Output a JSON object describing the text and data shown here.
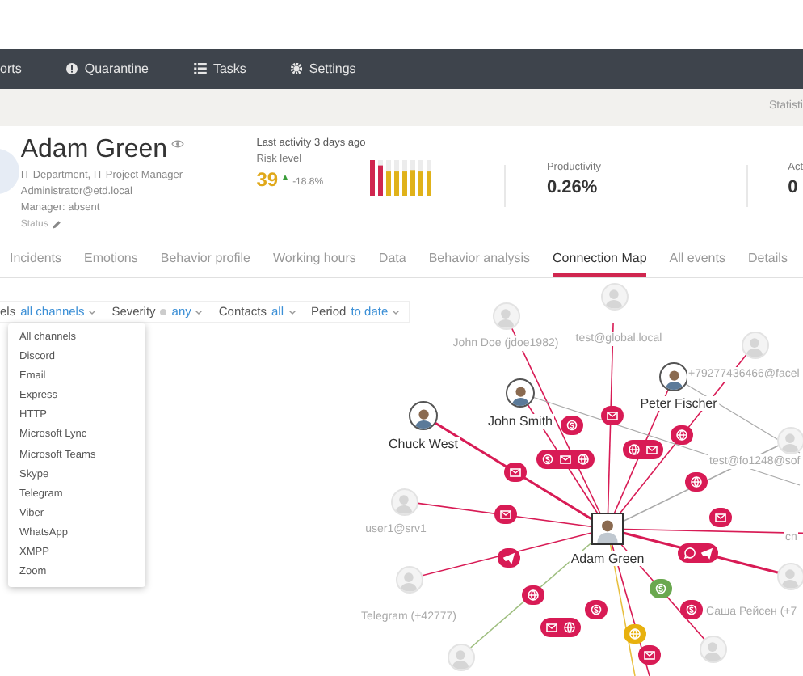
{
  "nav": {
    "items": [
      {
        "label": "orts"
      },
      {
        "label": "Quarantine"
      },
      {
        "label": "Tasks"
      },
      {
        "label": "Settings"
      }
    ]
  },
  "sub_bar": {
    "link": "Statisti"
  },
  "profile": {
    "name": "Adam Green",
    "department": "IT Department, IT Project Manager",
    "email": "Administrator@etd.local",
    "manager": "Manager: absent",
    "status": "Status"
  },
  "metrics": {
    "last_activity": "Last activity 3 days ago",
    "risk_label": "Risk level",
    "risk_value": "39",
    "risk_change": "-18.8%",
    "productivity_label": "Productivity",
    "productivity_value": "0.26%",
    "activity_label": "Act",
    "activity_value": "0"
  },
  "tabs": [
    {
      "label": "Incidents",
      "selected": false
    },
    {
      "label": "Emotions",
      "selected": false
    },
    {
      "label": "Behavior profile",
      "selected": false
    },
    {
      "label": "Working hours",
      "selected": false
    },
    {
      "label": "Data",
      "selected": false
    },
    {
      "label": "Behavior analysis",
      "selected": false
    },
    {
      "label": "Connection Map",
      "selected": true
    },
    {
      "label": "All events",
      "selected": false
    },
    {
      "label": "Details",
      "selected": false
    }
  ],
  "filters": [
    {
      "label": "els",
      "value": "all channels"
    },
    {
      "label": "Severity",
      "value": "any"
    },
    {
      "label": "Contacts",
      "value": "all"
    },
    {
      "label": "Period",
      "value": "to date"
    }
  ],
  "channel_menu": {
    "items": [
      "All channels",
      "Discord",
      "Email",
      "Express",
      "HTTP",
      "Microsoft Lync",
      "Microsoft Teams",
      "Skype",
      "Telegram",
      "Viber",
      "WhatsApp",
      "XMPP",
      "Zoom"
    ]
  },
  "graph": {
    "center": {
      "name": "Adam Green"
    },
    "contacts": [
      {
        "name": "John Doe (jdoe1982)",
        "kind": "placeholder"
      },
      {
        "name": "test@global.local",
        "kind": "placeholder"
      },
      {
        "name": "Peter Fischer",
        "kind": "photo"
      },
      {
        "name": "+79277436466@facel",
        "kind": "placeholder"
      },
      {
        "name": "John Smith",
        "kind": "photo"
      },
      {
        "name": "Chuck West",
        "kind": "photo"
      },
      {
        "name": "user1@srv1",
        "kind": "placeholder"
      },
      {
        "name": "Telegram (+42777)",
        "kind": "placeholder"
      },
      {
        "name": "test@fo1248@sof",
        "kind": "placeholder"
      },
      {
        "name": "cn",
        "kind": "placeholder"
      },
      {
        "name": "Саша Рейсен (+7",
        "kind": "placeholder"
      },
      {
        "kind": "placeholder"
      },
      {
        "kind": "placeholder"
      }
    ],
    "links": [
      {
        "color": "#d81b55"
      },
      {
        "color": "#d81b55"
      },
      {
        "color": "#d81b55"
      },
      {
        "color": "#d81b55"
      },
      {
        "color": "#d81b55"
      },
      {
        "color": "#d81b55"
      },
      {
        "color": "#d81b55"
      },
      {
        "color": "#d81b55"
      },
      {
        "color": "#d81b55"
      },
      {
        "color": "#d81b55"
      },
      {
        "color": "#d81b55"
      },
      {
        "color": "#d81b55"
      },
      {
        "color": "#6aa84f"
      },
      {
        "color": "#d81b55"
      },
      {
        "color": "#d81b55"
      },
      {
        "color": "#d81b55"
      },
      {
        "color": "#e8b10e"
      },
      {
        "color": "#d81b55"
      }
    ]
  }
}
